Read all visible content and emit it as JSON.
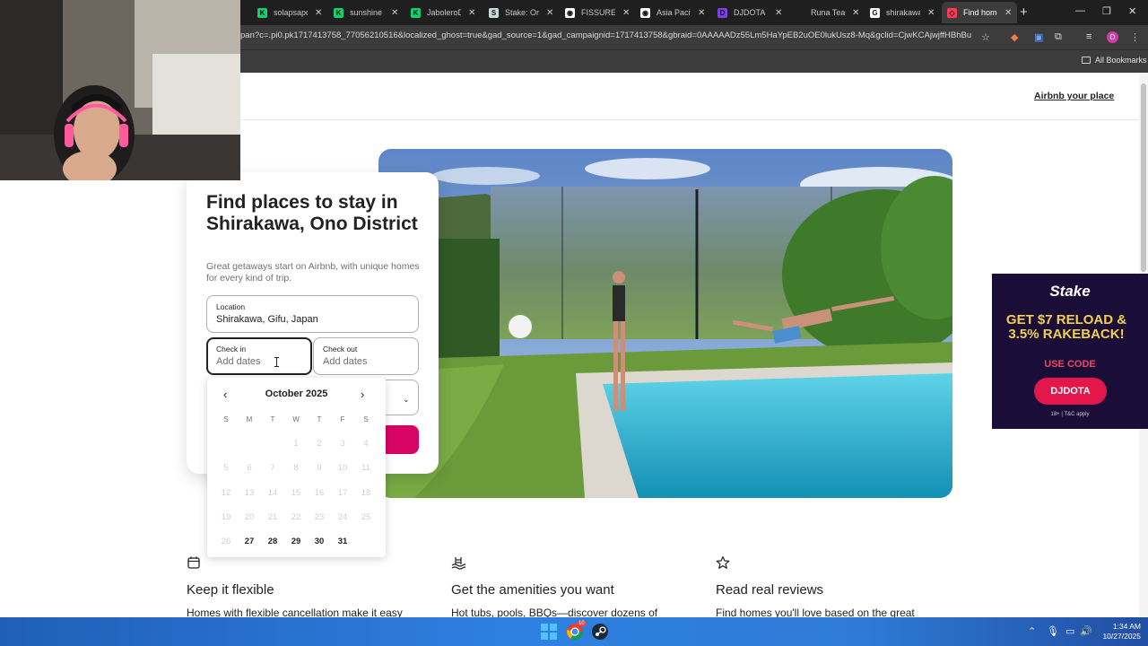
{
  "browser": {
    "tabs": [
      {
        "label": "solapsapd",
        "color": "#0fd170",
        "glyph": "K"
      },
      {
        "label": "sunshine",
        "color": "#0fd170",
        "glyph": "K"
      },
      {
        "label": "JaboleroD",
        "color": "#0fd170",
        "glyph": "K"
      },
      {
        "label": "Stake: Onl",
        "color": "#cfd8dc",
        "glyph": "S"
      },
      {
        "label": "FISSURE P",
        "color": "#ffffff",
        "glyph": "◉"
      },
      {
        "label": "Asia Pacif",
        "color": "#ffffff",
        "glyph": "◉"
      },
      {
        "label": "DJDOTA",
        "color": "#7b3fe4",
        "glyph": "D"
      },
      {
        "label": "Runa Tean",
        "color": "#1f1f1f",
        "glyph": ""
      },
      {
        "label": "shirakawa",
        "color": "#ffffff",
        "glyph": "G"
      },
      {
        "label": "Find home",
        "color": "#ff385c",
        "glyph": "◇"
      }
    ],
    "url": "pan?c=.pi0.pk1717413758_77056210516&localized_ghost=true&gad_source=1&gad_campaignid=1717413758&gbraid=0AAAAADz55Lm5HaYpEB2uOE0lukUsz8-Mq&gclid=CjwKCAjwjffHBhBuEiwA...",
    "bookmarks_label": "All Bookmarks",
    "profile_initial": "D"
  },
  "page": {
    "host_link": "Airbnb your place",
    "search": {
      "title": "Find places to stay in Shirakawa, Ono District",
      "subtitle": "Great getaways start on Airbnb, with unique homes for every kind of trip.",
      "location_label": "Location",
      "location_value": "Shirakawa, Gifu, Japan",
      "checkin_label": "Check in",
      "checkin_placeholder": "Add dates",
      "checkout_label": "Check out",
      "checkout_placeholder": "Add dates"
    },
    "calendar": {
      "month": "October 2025",
      "weekdays": [
        "S",
        "M",
        "T",
        "W",
        "T",
        "F",
        "S"
      ],
      "first_weekday_index": 3,
      "days_in_month": 31,
      "first_available_day": 27
    },
    "features": [
      {
        "icon": "calendar-icon",
        "title": "Keep it flexible",
        "desc": "Homes with flexible cancellation make it easy"
      },
      {
        "icon": "pool-icon",
        "title": "Get the amenities you want",
        "desc": "Hot tubs, pools, BBQs—discover dozens of"
      },
      {
        "icon": "star-icon",
        "title": "Read real reviews",
        "desc": "Find homes you'll love based on the great"
      }
    ]
  },
  "ad": {
    "brand": "Stake",
    "headline": "GET $7 RELOAD & 3.5% RAKEBACK!",
    "code_label": "USE CODE",
    "code": "DJDOTA",
    "fine_print": "18+ | T&C apply"
  },
  "taskbar": {
    "time": "1:34 AM",
    "date": "10/27/2025",
    "badge": "10"
  }
}
